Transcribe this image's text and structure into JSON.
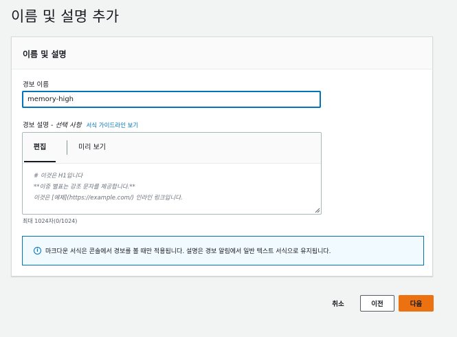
{
  "page": {
    "title": "이름 및 설명 추가"
  },
  "card": {
    "header_title": "이름 및 설명"
  },
  "alarm_name": {
    "label": "경보 이름",
    "value": "memory-high"
  },
  "description": {
    "label": "경보 설명",
    "separator": " - ",
    "optional": "선택 사항",
    "guide_link": "서식 가이드라인 보기",
    "tabs": {
      "edit": "편집",
      "preview": "미리 보기"
    },
    "placeholder_lines": [
      "# 이것은 H1입니다",
      "**이중 별표는 강조 문자를 제공합니다.**",
      "이것은 [예제](https://example.com/) 인라인 링크입니다."
    ],
    "char_count": "최대 1024자(0/1024)"
  },
  "info": {
    "icon": "info-icon",
    "text": "마크다운 서식은 콘솔에서 경보를 볼 때만 적용됩니다. 설명은 경보 알림에서 일반 텍스트 서식으로 유지됩니다."
  },
  "footer": {
    "cancel": "취소",
    "previous": "이전",
    "next": "다음"
  },
  "colors": {
    "accent": "#0073bb",
    "primary_button": "#ec7211",
    "background": "#f2f3f3"
  }
}
